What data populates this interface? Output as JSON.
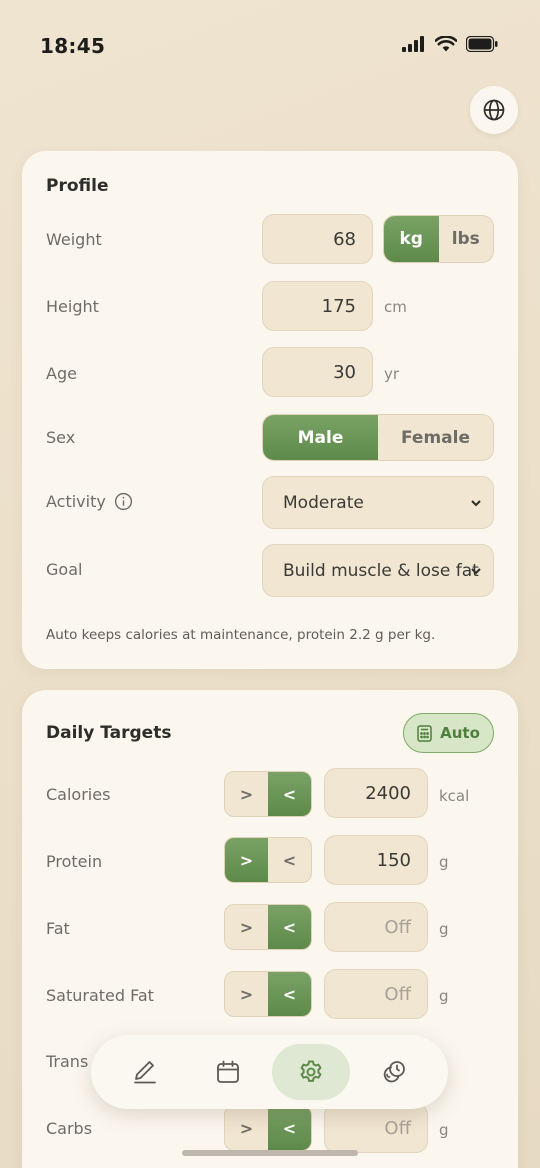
{
  "status": {
    "time": "18:45"
  },
  "profile": {
    "title": "Profile",
    "weight": {
      "label": "Weight",
      "value": "68",
      "units": [
        "kg",
        "lbs"
      ],
      "selected_unit": "kg"
    },
    "height": {
      "label": "Height",
      "value": "175",
      "unit": "cm"
    },
    "age": {
      "label": "Age",
      "value": "30",
      "unit": "yr"
    },
    "sex": {
      "label": "Sex",
      "options": [
        "Male",
        "Female"
      ],
      "selected": "Male"
    },
    "activity": {
      "label": "Activity",
      "value": "Moderate"
    },
    "goal": {
      "label": "Goal",
      "value": "Build muscle & lose fat"
    },
    "hint": "Auto keeps calories at maintenance, protein 2.2 g per kg."
  },
  "targets": {
    "title": "Daily Targets",
    "auto_label": "Auto",
    "gt": ">",
    "lt": "<",
    "rows": [
      {
        "label": "Calories",
        "value": "2400",
        "unit": "kcal",
        "mode": "<"
      },
      {
        "label": "Protein",
        "value": "150",
        "unit": "g",
        "mode": ">"
      },
      {
        "label": "Fat",
        "value": "Off",
        "unit": "g",
        "mode": "<"
      },
      {
        "label": "Saturated Fat",
        "value": "Off",
        "unit": "g",
        "mode": "<"
      },
      {
        "label": "Trans",
        "value": "",
        "unit": "",
        "mode": ""
      },
      {
        "label": "Carbs",
        "value": "Off",
        "unit": "g",
        "mode": "<"
      }
    ]
  },
  "nav": {
    "items": [
      "pencil-icon",
      "calendar-icon",
      "gear-icon",
      "history-icon"
    ],
    "active": "gear-icon"
  },
  "colors": {
    "accent": "#5d8a4b",
    "background": "#ebdfc9",
    "card": "#fbf7ef"
  }
}
